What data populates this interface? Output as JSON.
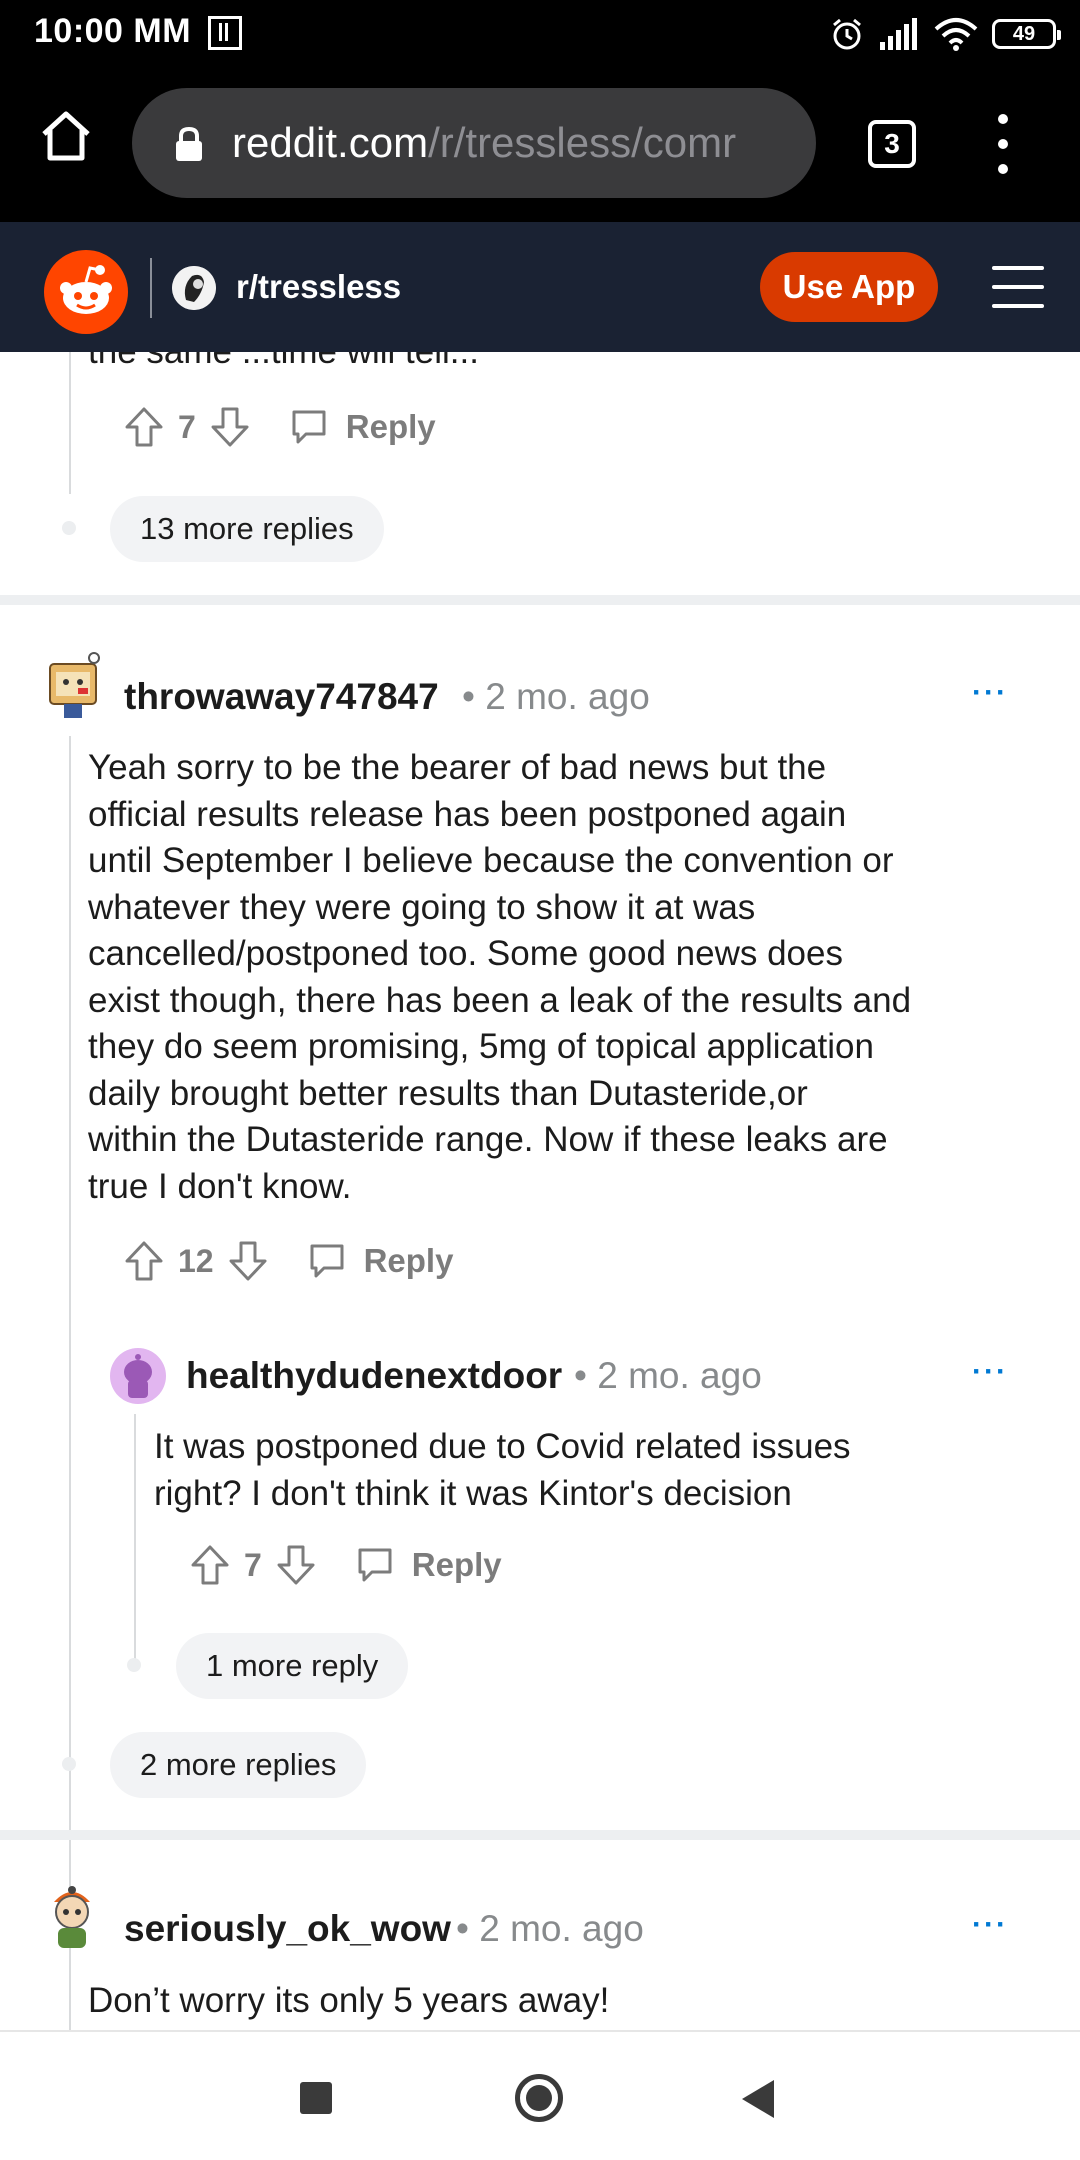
{
  "status_bar": {
    "time": "10:00 MM",
    "battery": "49"
  },
  "browser": {
    "url_host": "reddit.com",
    "url_path": "/r/tressless/comr",
    "tab_count": "3"
  },
  "header": {
    "subreddit": "r/tressless",
    "use_app_label": "Use App"
  },
  "thread": {
    "cut_off_text": "the same ...time will tell...",
    "top_comment": {
      "score": "7",
      "reply_label": "Reply",
      "more_replies": "13 more replies"
    },
    "comments": [
      {
        "username": "throwaway747847",
        "age": "• 2 mo. ago",
        "body_lines": [
          "Yeah sorry to be the bearer of bad news but the",
          "official results release has been postponed again",
          "until September I believe because the convention or",
          "whatever they were going to show it at was",
          "cancelled/postponed too. Some good news does",
          "exist though, there has been a leak of the results and",
          "they do seem promising, 5mg of topical application",
          "daily brought better results than Dutasteride,or",
          "within the Dutasteride range. Now if these leaks are",
          "true I don't know."
        ],
        "score": "12",
        "reply_label": "Reply",
        "more_replies": "2 more replies"
      },
      {
        "username": "healthydudenextdoor",
        "age": "• 2 mo. ago",
        "body_lines": [
          "It was postponed due to Covid related issues",
          "right? I don't think it was Kintor's decision"
        ],
        "score": "7",
        "reply_label": "Reply",
        "more_replies": "1 more reply"
      },
      {
        "username": "seriously_ok_wow",
        "age": "• 2 mo. ago",
        "body_lines": [
          "Don’t worry its only 5 years away!"
        ]
      }
    ],
    "more_options": "···"
  },
  "colors": {
    "reddit_orange": "#ff4500",
    "use_app_bg": "#d93a00",
    "header_bg": "#1a2233",
    "link_blue": "#0079d3"
  },
  "icons": [
    "home-icon",
    "lock-icon",
    "tabs-icon",
    "menu-icon",
    "reddit-logo-icon",
    "upvote-icon",
    "downvote-icon",
    "comment-icon",
    "back-icon",
    "home-circle-icon",
    "recents-icon"
  ]
}
